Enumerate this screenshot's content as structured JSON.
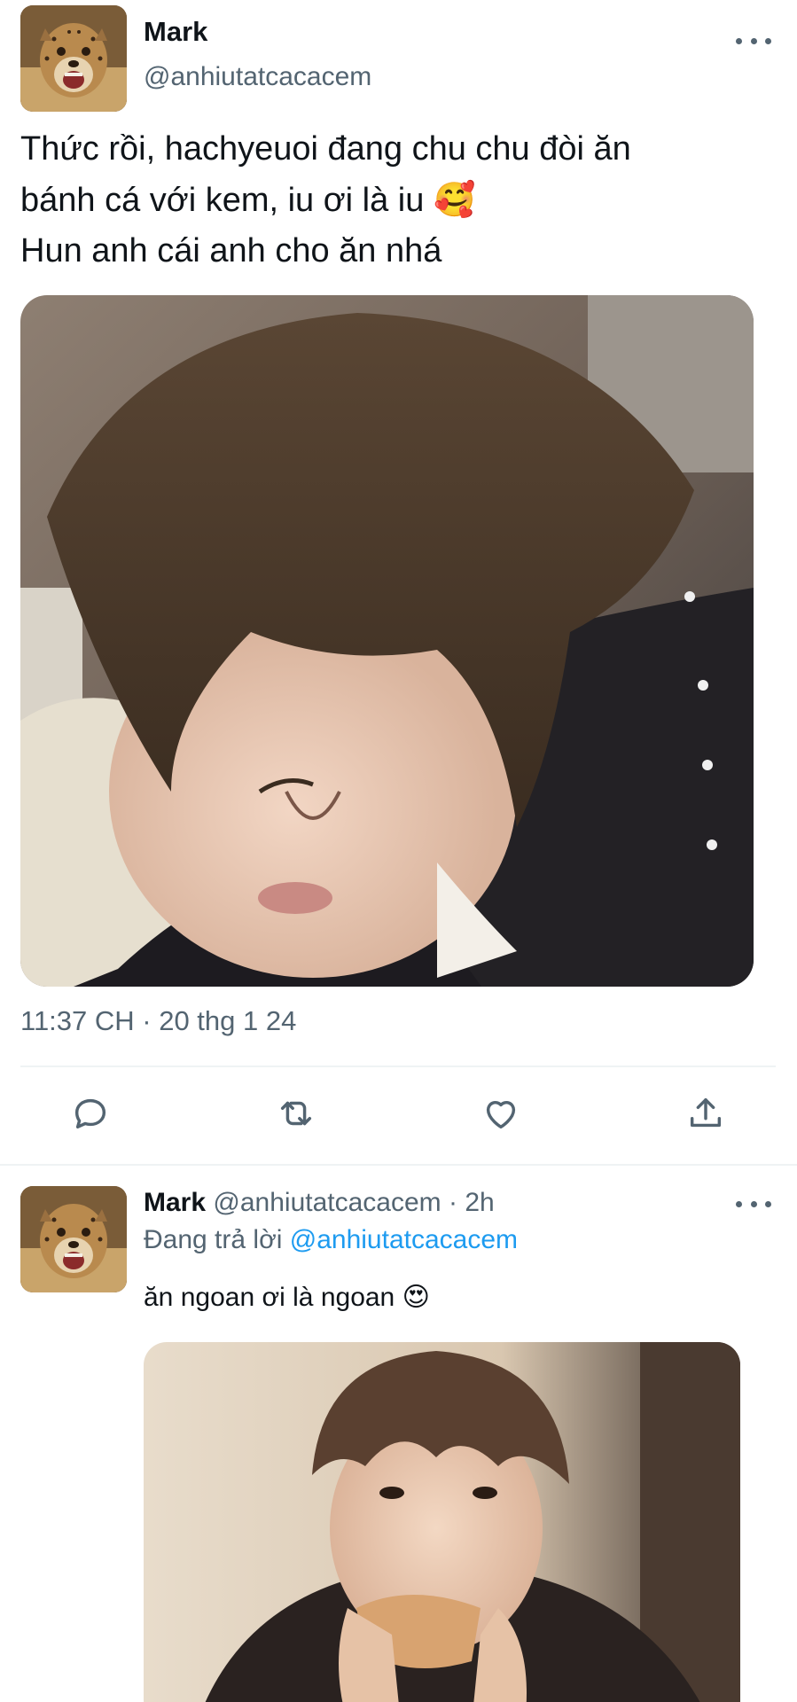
{
  "tweet": {
    "author_name": "Mark",
    "author_handle": "@anhiutatcacacem",
    "text_line1": "Thức rồi, hachyeuoi đang chu chu đòi ăn",
    "text_line2": "bánh cá với kem, iu ơi là iu",
    "text_line2_emoji": "🥰",
    "text_line3": "Hun anh cái anh cho ăn nhá",
    "timestamp": "11:37 CH · 20 thg 1 24",
    "actions": [
      "reply-icon",
      "retweet-icon",
      "like-icon",
      "share-icon"
    ]
  },
  "reply": {
    "author_name": "Mark",
    "author_handle": "@anhiutatcacacem",
    "time": "· 2h",
    "replying_label": "Đang trả lời",
    "replying_mention": "@anhiutatcacacem",
    "text": "ăn ngoan ơi là ngoan",
    "text_emoji": "😍"
  },
  "colors": {
    "text": "#0f1419",
    "secondary": "#536471",
    "link": "#1d9bf0",
    "divider": "#eff3f4"
  }
}
